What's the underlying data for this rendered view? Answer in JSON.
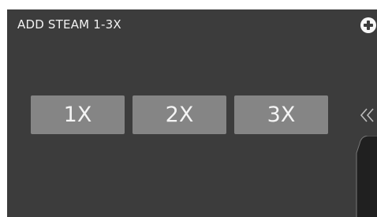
{
  "header": {
    "title": "ADD STEAM 1-3X"
  },
  "options": [
    {
      "label": "1X"
    },
    {
      "label": "2X"
    },
    {
      "label": "3X"
    }
  ],
  "icons": {
    "add": "plus-circle-icon",
    "expand": "double-chevron-left-icon"
  },
  "colors": {
    "panel_bg": "#3c3c3c",
    "button_bg": "#858585",
    "text": "#f2f2f2"
  }
}
